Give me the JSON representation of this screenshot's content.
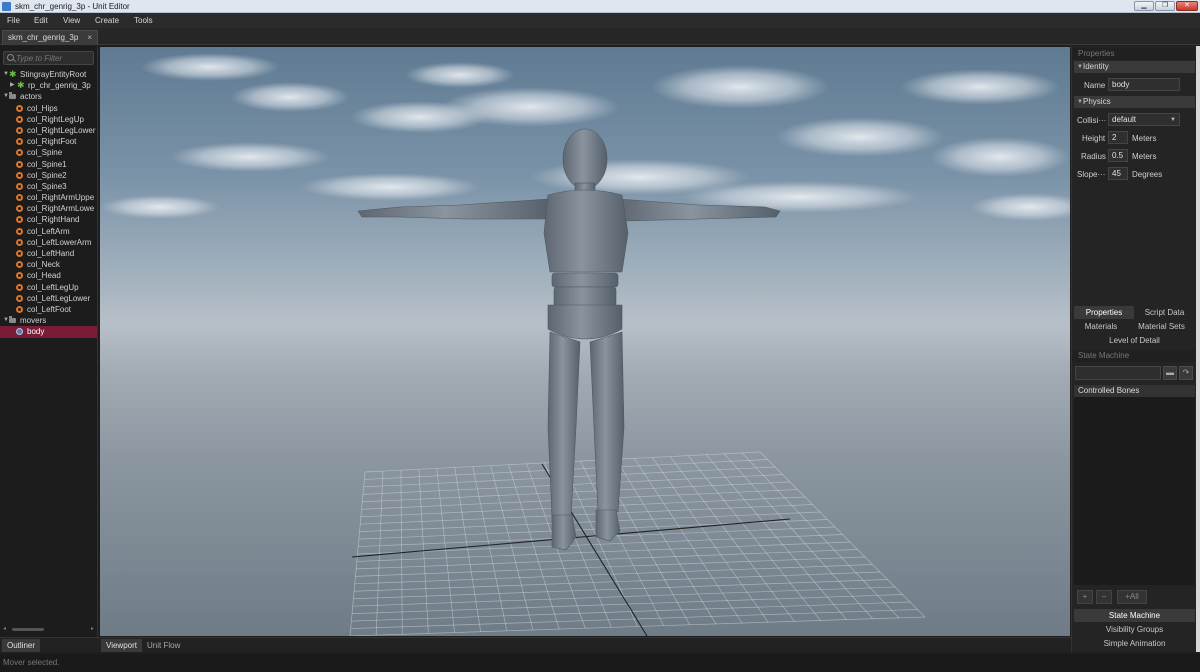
{
  "window": {
    "title": "skm_chr_genrig_3p - Unit Editor",
    "controls": {
      "minimize": "▁",
      "maximize": "❐",
      "close": "✕"
    }
  },
  "menu": [
    "File",
    "Edit",
    "View",
    "Create",
    "Tools"
  ],
  "document_tab": {
    "label": "skm_chr_genrig_3p",
    "close": "×"
  },
  "outliner": {
    "filter_placeholder": "Type to Filter",
    "nodes": [
      {
        "label": "StingrayEntityRoot",
        "icon": "root-icon",
        "level": 0,
        "arrow": "▼"
      },
      {
        "label": "rp_chr_genrig_3p",
        "icon": "root-icon",
        "level": 1,
        "arrow": "▶"
      },
      {
        "label": "actors",
        "icon": "folder-icon",
        "level": 0,
        "arrow": "▼"
      },
      {
        "label": "col_Hips",
        "icon": "actor-icon",
        "level": 1
      },
      {
        "label": "col_RightLegUp",
        "icon": "actor-icon",
        "level": 1
      },
      {
        "label": "col_RightLegLower",
        "icon": "actor-icon",
        "level": 1
      },
      {
        "label": "col_RightFoot",
        "icon": "actor-icon",
        "level": 1
      },
      {
        "label": "col_Spine",
        "icon": "actor-icon",
        "level": 1
      },
      {
        "label": "col_Spine1",
        "icon": "actor-icon",
        "level": 1
      },
      {
        "label": "col_Spine2",
        "icon": "actor-icon",
        "level": 1
      },
      {
        "label": "col_Spine3",
        "icon": "actor-icon",
        "level": 1
      },
      {
        "label": "col_RightArmUppe",
        "icon": "actor-icon",
        "level": 1
      },
      {
        "label": "col_RightArmLowe",
        "icon": "actor-icon",
        "level": 1
      },
      {
        "label": "col_RightHand",
        "icon": "actor-icon",
        "level": 1
      },
      {
        "label": "col_LeftArm",
        "icon": "actor-icon",
        "level": 1
      },
      {
        "label": "col_LeftLowerArm",
        "icon": "actor-icon",
        "level": 1
      },
      {
        "label": "col_LeftHand",
        "icon": "actor-icon",
        "level": 1
      },
      {
        "label": "col_Neck",
        "icon": "actor-icon",
        "level": 1
      },
      {
        "label": "col_Head",
        "icon": "actor-icon",
        "level": 1
      },
      {
        "label": "col_LeftLegUp",
        "icon": "actor-icon",
        "level": 1
      },
      {
        "label": "col_LeftLegLower",
        "icon": "actor-icon",
        "level": 1
      },
      {
        "label": "col_LeftFoot",
        "icon": "actor-icon",
        "level": 1
      },
      {
        "label": "movers",
        "icon": "folder-icon",
        "level": 0,
        "arrow": "▼"
      },
      {
        "label": "body",
        "icon": "mover-icon",
        "level": 1,
        "selected": true
      }
    ],
    "scroll_left": "◂",
    "scroll_right": "▸"
  },
  "bottom_tabs": [
    "Outliner",
    "Viewport",
    "Unit Flow"
  ],
  "status": "Mover selected.",
  "properties": {
    "panel_title": "Properties",
    "identity": {
      "header": "Identity",
      "name_label": "Name",
      "name_value": "body"
    },
    "physics": {
      "header": "Physics",
      "collision_label": "Collisi···",
      "collision_value": "default",
      "height_label": "Height",
      "height_value": "2",
      "height_unit": "Meters",
      "radius_label": "Radius",
      "radius_value": "0.5",
      "radius_unit": "Meters",
      "slope_label": "Slope···",
      "slope_value": "45",
      "slope_unit": "Degrees"
    },
    "tabs_row1": [
      "Properties",
      "Script Data"
    ],
    "tabs_row2": [
      "Materials",
      "Material Sets"
    ],
    "tab_row3": "Level of Detail"
  },
  "state_machine": {
    "panel_title": "State Machine",
    "controlled_bones": "Controlled Bones",
    "add": "+",
    "remove": "−",
    "add_all": "+All",
    "bottom_tabs": [
      "State Machine",
      "Visibility Groups",
      "Simple Animation"
    ]
  },
  "colors": {
    "selection": "#7a1c35",
    "actor_icon": "#e0752c",
    "root_icon": "#6bbf3b"
  }
}
